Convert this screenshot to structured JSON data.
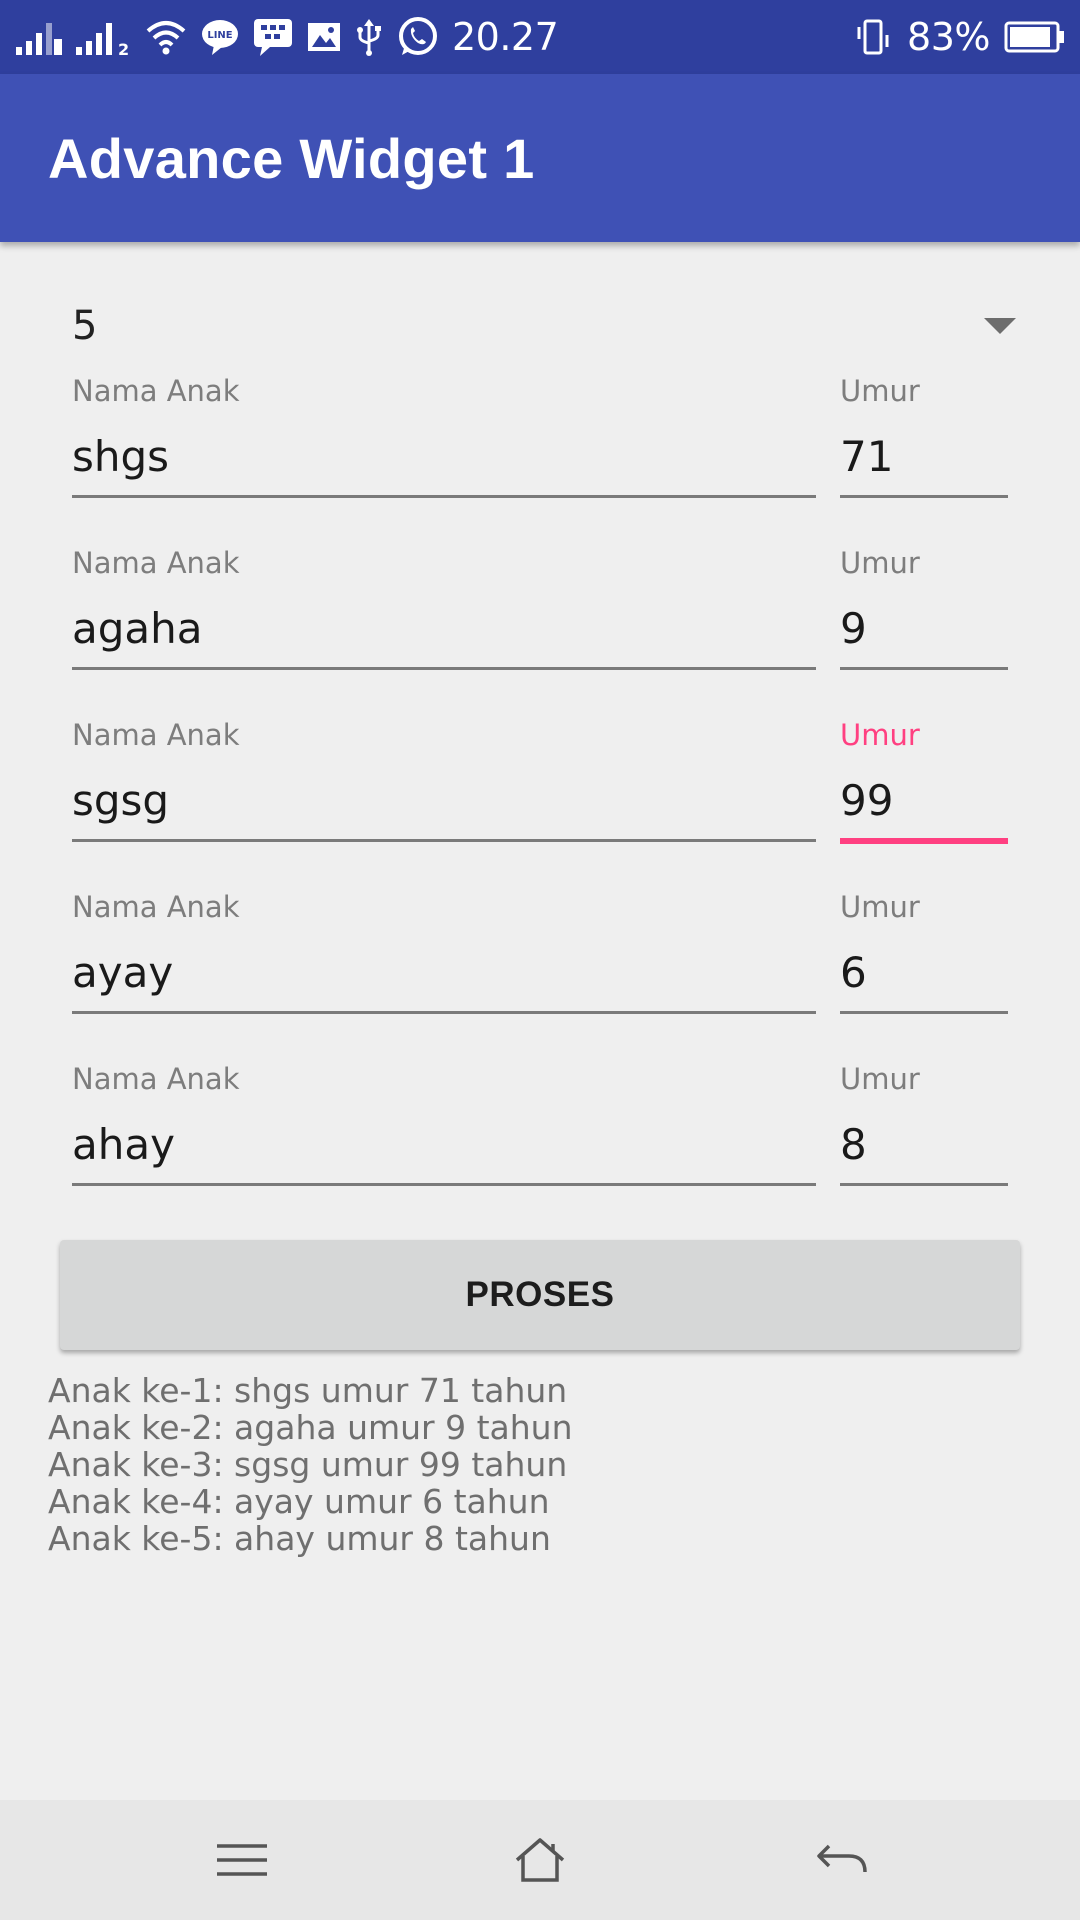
{
  "status_bar": {
    "time": "20.27",
    "battery_percent": "83%",
    "sim1": "1",
    "sim2": "2",
    "icons": [
      "signal-icon",
      "signal-icon",
      "wifi-icon",
      "line-app-icon",
      "bbm-icon",
      "gallery-icon",
      "usb-icon",
      "whatsapp-icon",
      "vibrate-icon",
      "battery-icon"
    ]
  },
  "app_bar": {
    "title": "Advance Widget 1"
  },
  "spinner": {
    "selected": "5"
  },
  "form": {
    "name_label": "Nama Anak",
    "age_label": "Umur",
    "rows": [
      {
        "name": "shgs",
        "age": "71"
      },
      {
        "name": "agaha",
        "age": "9"
      },
      {
        "name": "sgsg",
        "age": "99"
      },
      {
        "name": "ayay",
        "age": "6"
      },
      {
        "name": "ahay",
        "age": "8"
      }
    ],
    "focused_row": 3
  },
  "button": {
    "label": "PROSES"
  },
  "results": [
    "Anak ke-1: shgs umur 71 tahun",
    "Anak ke-2: agaha umur 9 tahun",
    "Anak ke-3: sgsg umur 99 tahun",
    "Anak ke-4: ayay umur 6 tahun",
    "Anak ke-5: ahay umur 8 tahun"
  ],
  "nav_bar": {
    "icons": [
      "menu-icon",
      "home-icon",
      "back-icon"
    ]
  },
  "colors": {
    "status_bar": "#2f3f9e",
    "app_bar": "#3f51b5",
    "accent": "#ff4081",
    "background": "#efefef",
    "button": "#d6d7d7"
  }
}
